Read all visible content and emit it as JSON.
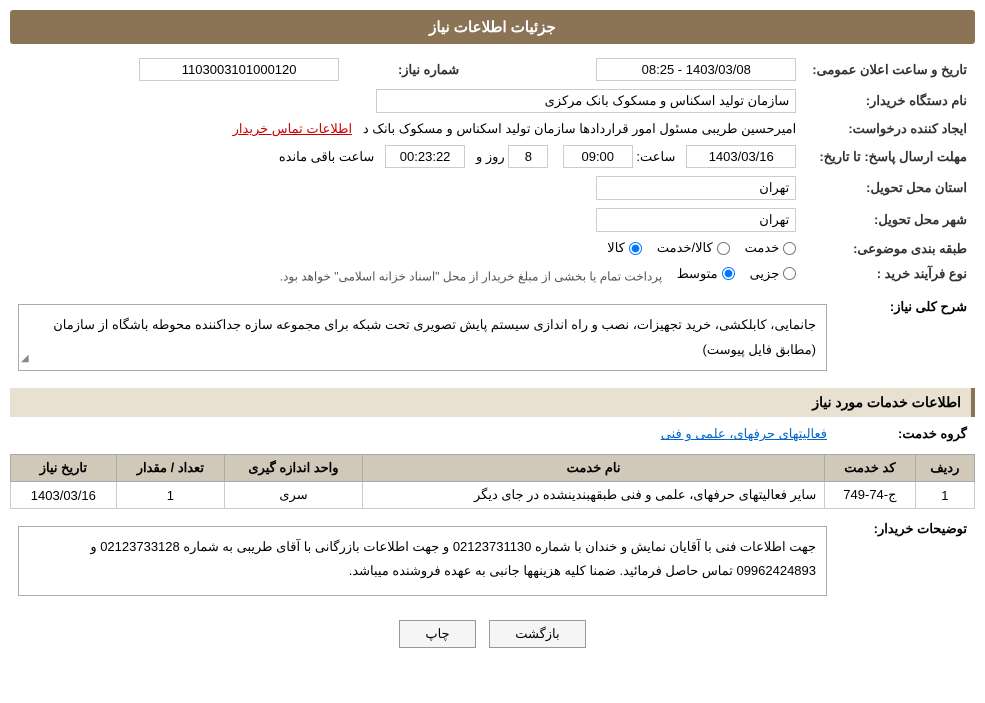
{
  "page": {
    "title": "جزئیات اطلاعات نیاز"
  },
  "header": {
    "announce_label": "تاریخ و ساعت اعلان عمومی:",
    "announce_value": "1403/03/08 - 08:25",
    "need_number_label": "شماره نیاز:",
    "need_number_value": "1103003101000120",
    "buyer_org_label": "نام دستگاه خریدار:",
    "buyer_org_value": "سازمان تولید اسکناس و مسکوک بانک مرکزی",
    "creator_label": "ایجاد کننده درخواست:",
    "creator_value": "امیرحسین طریبی مسئول امور قراردادها سازمان تولید اسکناس و مسکوک بانک د",
    "creator_link": "اطلاعات تماس خریدار",
    "deadline_label": "مهلت ارسال پاسخ: تا تاریخ:",
    "deadline_date": "1403/03/16",
    "deadline_time_label": "ساعت:",
    "deadline_time": "09:00",
    "deadline_days_label": "روز و",
    "deadline_days": "8",
    "deadline_remain_label": "ساعت باقی مانده",
    "deadline_remain": "00:23:22",
    "province_label": "استان محل تحویل:",
    "province_value": "تهران",
    "city_label": "شهر محل تحویل:",
    "city_value": "تهران",
    "category_label": "طبقه بندی موضوعی:",
    "category_options": [
      "خدمت",
      "کالا/خدمت",
      "کالا"
    ],
    "category_selected": "کالا",
    "purchase_type_label": "نوع فرآیند خرید :",
    "purchase_options": [
      "جزیی",
      "متوسط"
    ],
    "purchase_note": "پرداخت تمام یا بخشی از مبلغ خریدار از محل \"اسناد خزانه اسلامی\" خواهد بود."
  },
  "need_description": {
    "section_title": "شرح کلی نیاز:",
    "text": "جانمایی، کابلکشی، خرید تجهیزات، نصب و راه اندازی سیستم پایش تصویری تحت شبکه برای مجموعه سازه جداکننده محوطه باشگاه از سازمان (مطابق فایل پیوست)"
  },
  "services_section": {
    "section_title": "اطلاعات خدمات مورد نیاز",
    "service_group_label": "گروه خدمت:",
    "service_group_value": "فعالیتهای حرفهای، علمی و فنی",
    "table": {
      "headers": [
        "ردیف",
        "کد خدمت",
        "نام خدمت",
        "واحد اندازه گیری",
        "تعداد / مقدار",
        "تاریخ نیاز"
      ],
      "rows": [
        {
          "row_num": "1",
          "service_code": "ج-74-749",
          "service_name": "سایر فعالیتهای حرفهای، علمی و فنی طبقهبندینشده در جای دیگر",
          "unit": "سری",
          "quantity": "1",
          "need_date": "1403/03/16"
        }
      ]
    }
  },
  "buyer_notes": {
    "label": "توضیحات خریدار:",
    "text": "جهت اطلاعات فنی با آقایان نمایش و خندان با شماره 02123731130 و جهت اطلاعات بازرگانی با آقای طریبی به شماره 02123733128 و 09962424893 تماس حاصل فرمائید. ضمنا کلیه هزینهها جانبی به عهده فروشنده میباشد."
  },
  "buttons": {
    "print": "چاپ",
    "back": "بازگشت"
  }
}
